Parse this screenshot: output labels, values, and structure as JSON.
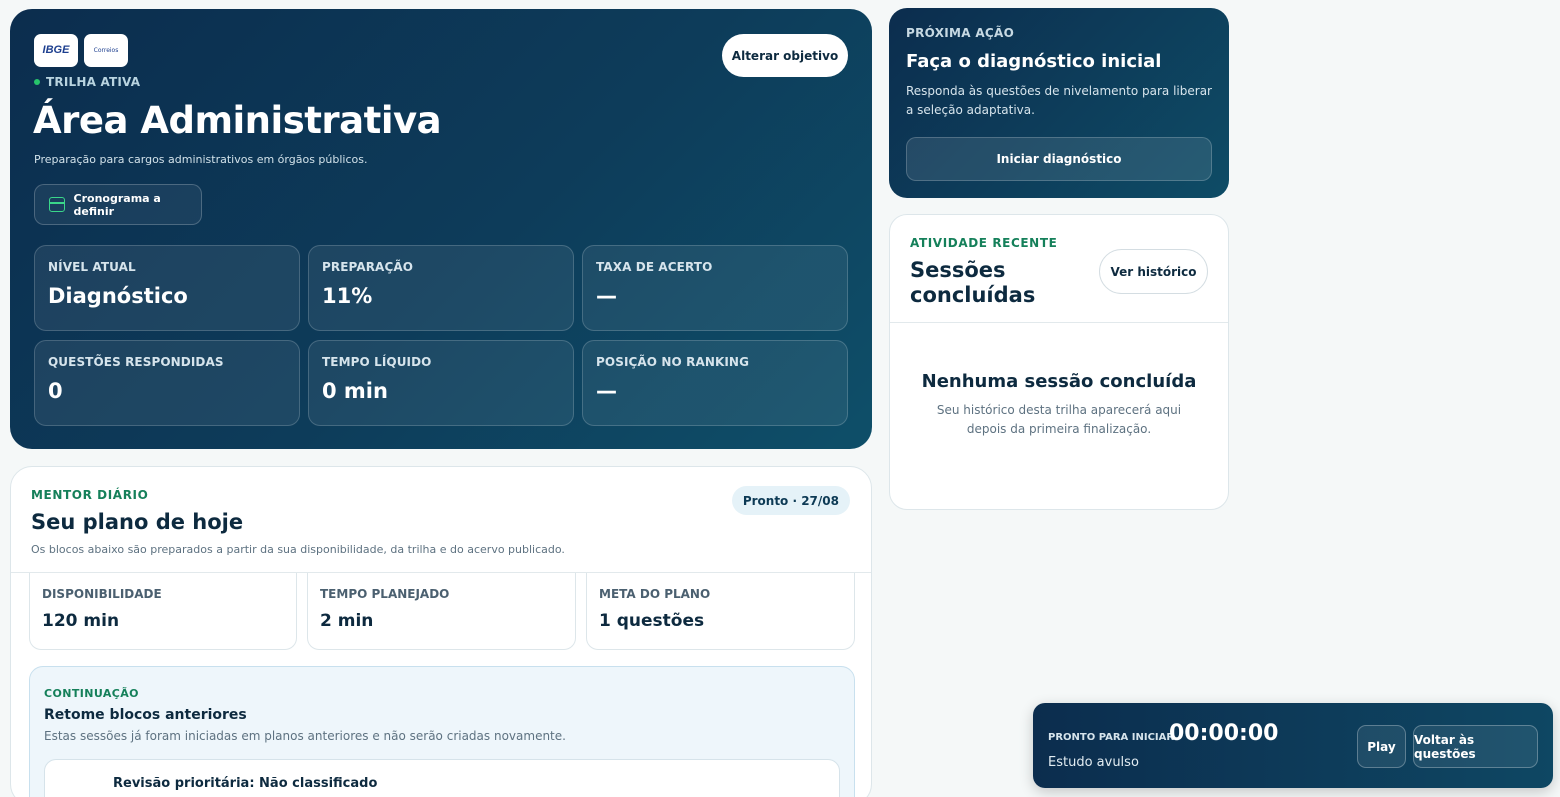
{
  "hero": {
    "logos": [
      "IBGE",
      "Correios"
    ],
    "trilha_label": "TRILHA ATIVA",
    "title": "Área Administrativa",
    "subtitle": "Preparação para cargos administrativos em órgãos públicos.",
    "cronograma_label": "Cronograma a definir",
    "alterar_label": "Alterar objetivo",
    "stats": [
      {
        "label": "NÍVEL ATUAL",
        "value": "Diagnóstico"
      },
      {
        "label": "PREPARAÇÃO",
        "value": "11%"
      },
      {
        "label": "TAXA DE ACERTO",
        "value": "—"
      },
      {
        "label": "QUESTÕES RESPONDIDAS",
        "value": "0"
      },
      {
        "label": "TEMPO LÍQUIDO",
        "value": "0 min"
      },
      {
        "label": "POSIÇÃO NO RANKING",
        "value": "—"
      }
    ]
  },
  "next_action": {
    "eyebrow": "PRÓXIMA AÇÃO",
    "title": "Faça o diagnóstico inicial",
    "description": "Responda às questões de nivelamento para liberar a seleção adaptativa.",
    "button_label": "Iniciar diagnóstico"
  },
  "activity": {
    "eyebrow": "ATIVIDADE RECENTE",
    "title": "Sessões concluídas",
    "button_label": "Ver histórico",
    "empty_title": "Nenhuma sessão concluída",
    "empty_description": "Seu histórico desta trilha aparecerá aqui depois da primeira finalização."
  },
  "mentor": {
    "eyebrow": "MENTOR DIÁRIO",
    "title": "Seu plano de hoje",
    "description": "Os blocos abaixo são preparados a partir da sua disponibilidade, da trilha e do acervo publicado.",
    "badge": "Pronto · 27/08",
    "stats": [
      {
        "label": "DISPONIBILIDADE",
        "value": "120 min"
      },
      {
        "label": "TEMPO PLANEJADO",
        "value": "2 min"
      },
      {
        "label": "META DO PLANO",
        "value": "1 questões"
      }
    ],
    "continuation": {
      "eyebrow": "CONTINUAÇÃO",
      "title": "Retome blocos anteriores",
      "description": "Estas sessões já foram iniciadas em planos anteriores e não serão criadas novamente.",
      "items": [
        "Revisão prioritária: Não classificado"
      ]
    }
  },
  "timer": {
    "status_label": "PRONTO PARA INICIAR",
    "clock": "00:00:00",
    "mode": "Estudo avulso",
    "play_label": "Play",
    "back_label": "Voltar às questões"
  },
  "colors": {
    "navy": "#0c2d4e",
    "teal": "#0e4f69",
    "accent_green": "#15805a",
    "status_dot": "#27c46b"
  }
}
